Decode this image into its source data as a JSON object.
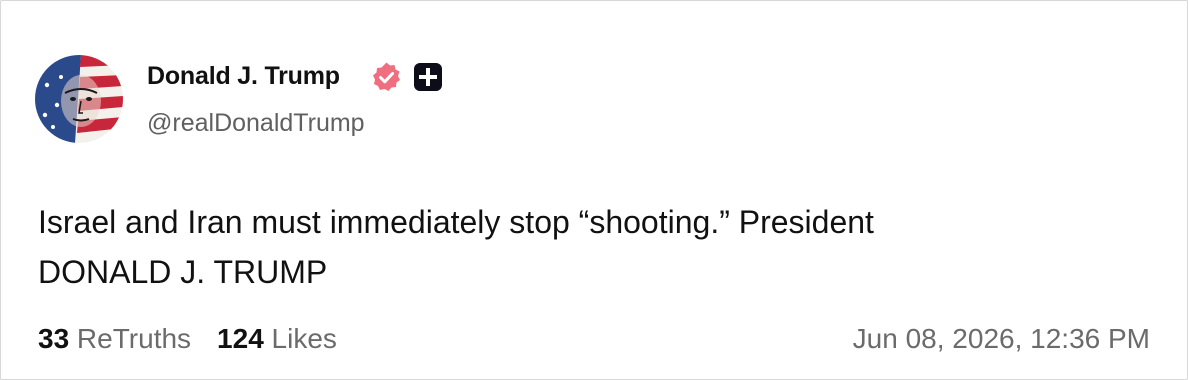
{
  "author": {
    "display_name": "Donald J. Trump",
    "handle": "@realDonaldTrump",
    "avatar_icon": "flag-portrait-avatar",
    "verified_icon": "verified-badge-icon",
    "verified_color": "#ef6f80",
    "plus_icon": "plus-badge-icon"
  },
  "post": {
    "text": "Israel and Iran must immediately stop “shooting.” President\nDONALD J. TRUMP"
  },
  "stats": {
    "retruths_count": "33",
    "retruths_label": " ReTruths",
    "likes_count": "124",
    "likes_label": " Likes"
  },
  "timestamp": "Jun 08, 2026, 12:36 PM"
}
